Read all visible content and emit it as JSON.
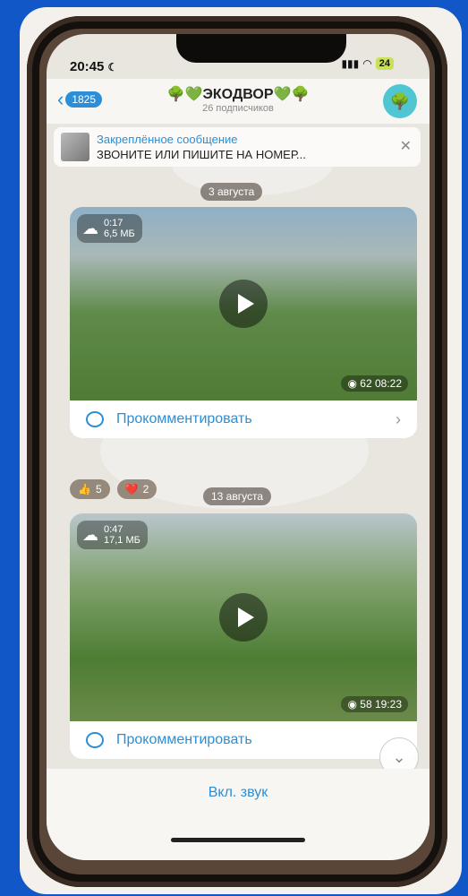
{
  "status_bar": {
    "time": "20:45",
    "battery": "24"
  },
  "header": {
    "back_count": "1825",
    "title": "🌳💚ЭКОДВОР💚🌳",
    "subtitle": "26 подписчиков"
  },
  "pinned": {
    "title": "Закреплённое сообщение",
    "text": "ЗВОНИТЕ ИЛИ ПИШИТЕ НА НОМЕР..."
  },
  "messages": [
    {
      "date": "3 августа",
      "duration": "0:17",
      "size": "6,5 МБ",
      "views": "62 08:22",
      "comment_label": "Прокомментировать"
    },
    {
      "date": "13 августа",
      "duration": "0:47",
      "size": "17,1 МБ",
      "views": "58 19:23",
      "comment_label": "Прокомментировать"
    }
  ],
  "reactions": [
    {
      "emoji": "👍",
      "count": "5"
    },
    {
      "emoji": "❤️",
      "count": "2"
    }
  ],
  "sound_toggle": "Вкл. звук",
  "icons": [
    "cloud-download-icon",
    "play-icon",
    "eye-icon",
    "comment-icon",
    "chevron-right-icon",
    "chevron-down-icon",
    "close-icon",
    "back-icon"
  ]
}
